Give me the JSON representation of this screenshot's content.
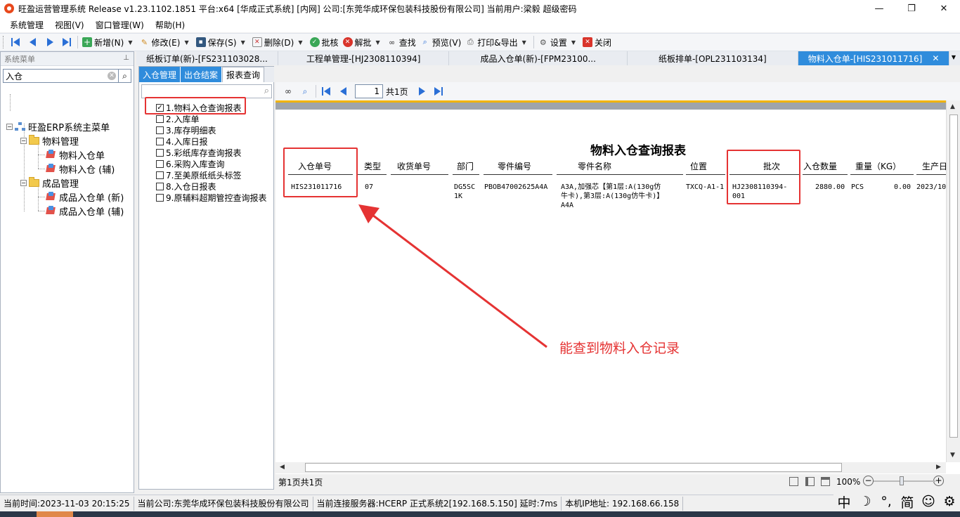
{
  "window": {
    "title": "旺盈运营管理系统 Release v1.23.1102.1851 平台:x64  [华成正式系统] [内网] 公司:[东莞华成环保包装科技股份有限公司] 当前用户:梁毅  超级密码",
    "minimize": "—",
    "maximize": "❐",
    "close": "✕"
  },
  "menubar": [
    "系统管理",
    "视图(V)",
    "窗口管理(W)",
    "帮助(H)"
  ],
  "toolbar": {
    "new": "新增(N)",
    "edit": "修改(E)",
    "save": "保存(S)",
    "delete": "删除(D)",
    "approve": "批核",
    "unapprove": "解批",
    "find": "查找",
    "preview": "预览(V)",
    "print_export": "打印&导出",
    "settings": "设置",
    "close": "关闭"
  },
  "doc_tabs": [
    "纸板订单(新)-[FS231103028...",
    "工程单管理-[HJ2308110394]",
    "成品入仓单(新)-[FPM23100...",
    "纸板排单-[OPL231103134]",
    "物料入仓单-[HIS231011716]"
  ],
  "left_panel": {
    "title": "系统菜单",
    "search_value": "入仓",
    "tree": {
      "root": "旺盈ERP系统主菜单",
      "group1": "物料管理",
      "g1_item1": "物料入仓单",
      "g1_item2": "物料入仓 (辅)",
      "group2": "成品管理",
      "g2_item1": "成品入仓单 (新)",
      "g2_item2": "成品入仓单 (辅)"
    }
  },
  "sub_tabs": [
    "入仓管理",
    "出仓结案",
    "报表查询"
  ],
  "reports": [
    "1.物料入仓查询报表",
    "2.入库单",
    "3.库存明细表",
    "4.入库日报",
    "5.彩纸库存查询报表",
    "6.采购入库查询",
    "7.至美原纸纸头标签",
    "8.入仓日报表",
    "9.原辅料超期管控查询报表"
  ],
  "viewer": {
    "page_value": "1",
    "total_pages": "共1页",
    "footer_pages": "第1页共1页",
    "zoom": "100%"
  },
  "report": {
    "title": "物料入仓查询报表",
    "columns": [
      "入仓单号",
      "类型",
      "收货单号",
      "部门",
      "零件编号",
      "零件名称",
      "位置",
      "批次",
      "入仓数量",
      "重量（KG）",
      "生产日"
    ],
    "row": {
      "no": "HIS231011716",
      "type": "07",
      "receipt": "",
      "dept_1": "DG5SC",
      "dept_2": "1K",
      "part_no": "PBOB47002625A4A",
      "part_name_1": "A3A,加强芯【第1层:A(130g仿",
      "part_name_2": "牛卡),第3层:A(130g仿牛卡)】",
      "part_name_3": "A4A",
      "location": "TXCQ-A1-1",
      "batch_1": "HJ2308110394-",
      "batch_2": "001",
      "qty": "2880.00",
      "unit": "PCS",
      "weight": "0.00",
      "date": "2023/10"
    }
  },
  "annotation": "能查到物料入仓记录",
  "statusbar": {
    "time": "当前时间:2023-11-03 20:15:25",
    "company": "当前公司:东莞华成环保包装科技股份有限公司",
    "server": "当前连接服务器:HCERP 正式系统2[192.168.5.150] 延时:7ms",
    "ip": "本机IP地址: 192.168.66.158"
  },
  "ime": [
    "中",
    "☽",
    "°,",
    "简",
    "☺",
    "⚙"
  ],
  "colors": {
    "accent": "#2f8cdc",
    "annotation_red": "#e53333",
    "gold_line": "#f1b400"
  }
}
